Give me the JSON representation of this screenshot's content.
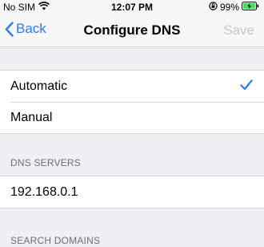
{
  "status_bar": {
    "carrier": "No SIM",
    "time": "12:07 PM",
    "battery": "99%"
  },
  "nav": {
    "back_label": "Back",
    "title": "Configure DNS",
    "save_label": "Save"
  },
  "mode": {
    "options": [
      "Automatic",
      "Manual"
    ],
    "selected": "Automatic"
  },
  "dns_servers": {
    "header": "DNS SERVERS",
    "entries": [
      "192.168.0.1"
    ]
  },
  "search_domains": {
    "header": "SEARCH DOMAINS"
  },
  "colors": {
    "accent": "#2f7ddf",
    "disabled": "#c7c7cc",
    "background": "#efeff4"
  }
}
